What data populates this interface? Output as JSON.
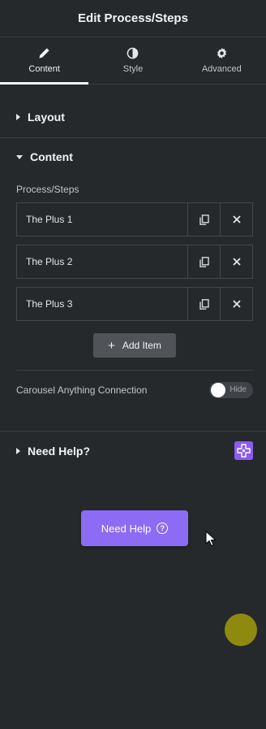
{
  "header": {
    "title": "Edit Process/Steps"
  },
  "tabs": [
    {
      "label": "Content",
      "icon": "pencil-icon",
      "active": true
    },
    {
      "label": "Style",
      "icon": "contrast-icon",
      "active": false
    },
    {
      "label": "Advanced",
      "icon": "gear-icon",
      "active": false
    }
  ],
  "sections": {
    "layout": {
      "title": "Layout",
      "expanded": false
    },
    "content": {
      "title": "Content",
      "expanded": true
    },
    "need_help": {
      "title": "Need Help?",
      "expanded": false
    }
  },
  "content": {
    "repeater_label": "Process/Steps",
    "items": [
      {
        "title": "The Plus 1"
      },
      {
        "title": "The Plus 2"
      },
      {
        "title": "The Plus 3"
      }
    ],
    "add_item_label": "Add Item",
    "carousel": {
      "label": "Carousel Anything Connection",
      "state_text": "Hide",
      "on": false
    }
  },
  "need_help_button": {
    "label": "Need Help",
    "icon": "question-circle-icon"
  },
  "colors": {
    "background": "#26292c",
    "accent": "#8c6cf4",
    "plus_icon": "#8a5cf0",
    "dot": "#8e8a0f"
  }
}
